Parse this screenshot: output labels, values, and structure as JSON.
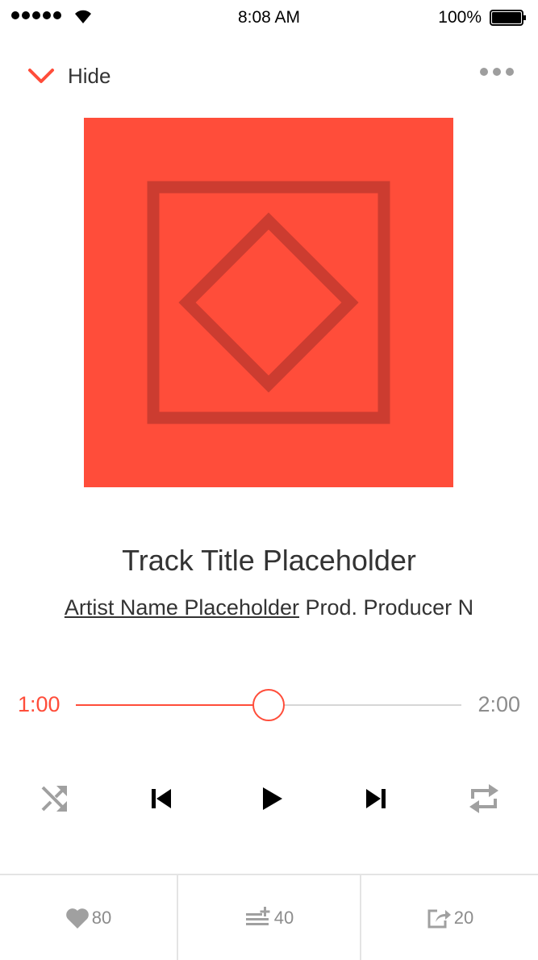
{
  "status_bar": {
    "time": "8:08 AM",
    "battery_percent": "100%",
    "signal_bars": 5,
    "icons": [
      "signal-icon",
      "wifi-icon",
      "battery-icon"
    ]
  },
  "header": {
    "hide_label": "Hide",
    "icons": [
      "chevron-down-icon",
      "more-icon"
    ]
  },
  "artwork": {
    "placeholder_icon": "image-placeholder-icon",
    "background": "#ff4d3a"
  },
  "track": {
    "title": "Track Title Placeholder",
    "artist": "Artist Name Placeholder",
    "producer": "Prod. Producer N"
  },
  "progress": {
    "elapsed": "1:00",
    "total": "2:00",
    "fraction": 0.5
  },
  "controls": {
    "icons": [
      "shuffle-icon",
      "previous-icon",
      "play-icon",
      "next-icon",
      "repeat-icon"
    ]
  },
  "stats": [
    {
      "icon": "heart-icon",
      "count": "80"
    },
    {
      "icon": "add-to-playlist-icon",
      "count": "40"
    },
    {
      "icon": "share-icon",
      "count": "20"
    }
  ],
  "colors": {
    "accent": "#ff4d3a",
    "muted": "#8c8c8c",
    "text": "#333333",
    "divider": "#e4e4e4"
  }
}
